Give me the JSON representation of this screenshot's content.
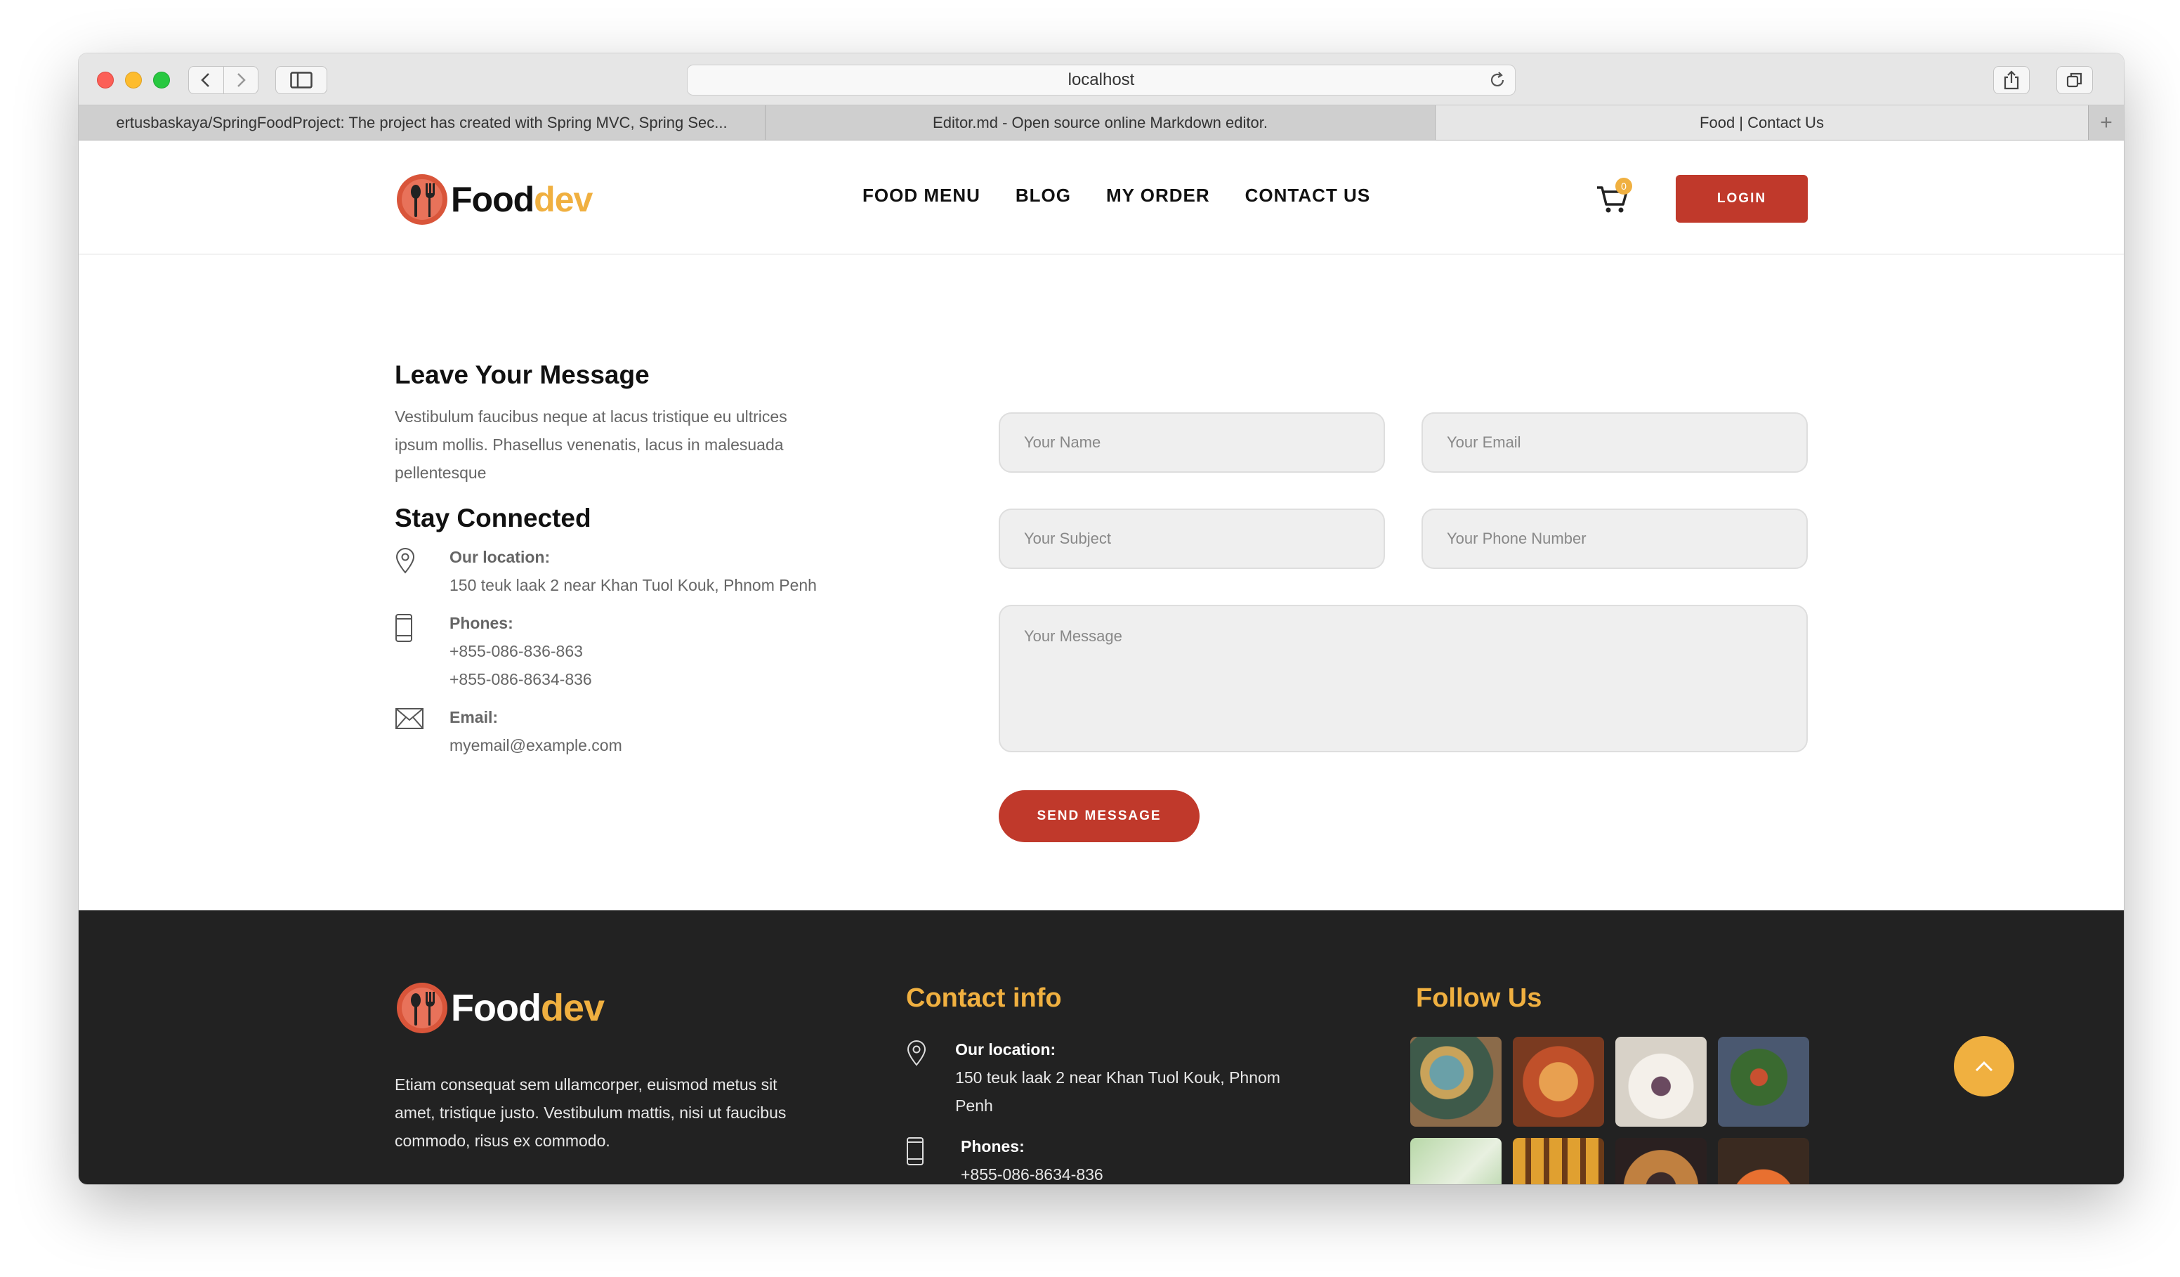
{
  "browser": {
    "url": "localhost",
    "tabs": [
      "ertusbaskaya/SpringFoodProject: The project has created with Spring MVC, Spring Sec...",
      "Editor.md - Open source online Markdown editor.",
      "Food | Contact Us"
    ],
    "new_tab": "+"
  },
  "header": {
    "logo_food": "Food",
    "logo_dev": "dev",
    "menu": [
      "FOOD MENU",
      "BLOG",
      "MY ORDER",
      "CONTACT US"
    ],
    "cart_count": "0",
    "login": "LOGIN"
  },
  "contact": {
    "title": "Leave Your Message",
    "intro": "Vestibulum faucibus neque at lacus tristique eu ultrices ipsum mollis. Phasellus venenatis, lacus in malesuada pellentesque",
    "stay_title": "Stay Connected",
    "location_label": "Our location:",
    "location": "150 teuk laak 2 near Khan Tuol Kouk, Phnom Penh",
    "phones_label": "Phones:",
    "phone1": "+855-086-836-863",
    "phone2": "+855-086-8634-836",
    "email_label": "Email:",
    "email": "myemail@example.com"
  },
  "form": {
    "name_placeholder": "Your Name",
    "email_placeholder": "Your Email",
    "subject_placeholder": "Your Subject",
    "phone_placeholder": "Your Phone Number",
    "message_placeholder": "Your Message",
    "send": "SEND MESSAGE"
  },
  "footer": {
    "logo_food": "Food",
    "logo_dev": "dev",
    "about": "Etiam consequat sem ullamcorper, euismod metus sit amet, tristique justo. Vestibulum mattis, nisi ut faucibus commodo, risus ex commodo.",
    "contact_title": "Contact info",
    "location_label": "Our location:",
    "location": "150 teuk laak 2 near Khan Tuol Kouk, Phnom Penh",
    "phones_label": "Phones:",
    "phone": "+855-086-8634-836",
    "follow_title": "Follow Us"
  },
  "colors": {
    "accent_red": "#c0392b",
    "accent_yellow": "#f0b040",
    "footer_bg": "#222222"
  }
}
